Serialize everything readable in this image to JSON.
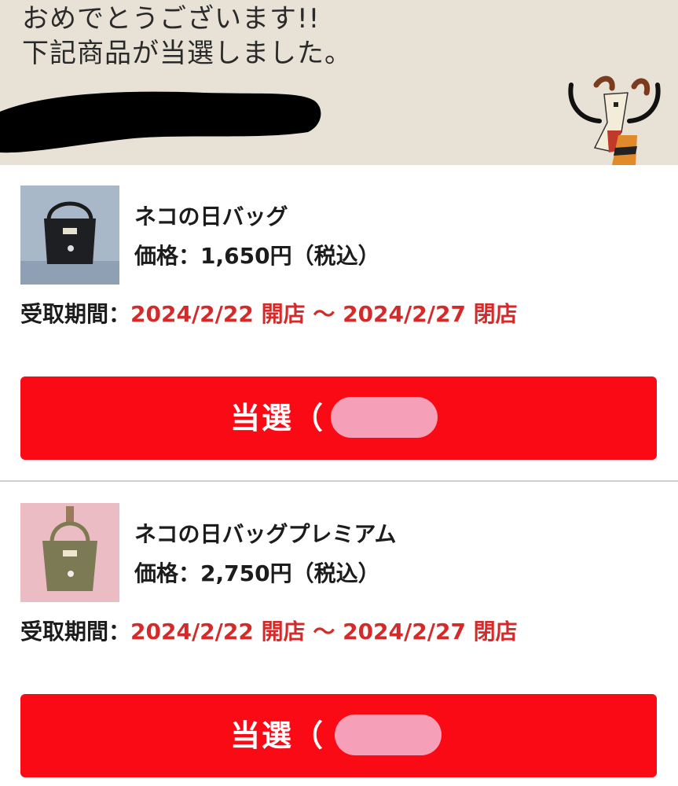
{
  "banner": {
    "line1": "おめでとうございます!!",
    "line2": "下記商品が当選しました。",
    "mascot_icon": "goat-mascot-icon"
  },
  "items": [
    {
      "name": "ネコの日バッグ",
      "price": "価格：1,650円（税込）",
      "period_label": "受取期間：",
      "period_value": "2024/2/22 開店 〜 2024/2/27 閉店",
      "button_label": "当選（",
      "image": "black-tote-bag-image"
    },
    {
      "name": "ネコの日バッグプレミアム",
      "price": "価格：2,750円（税込）",
      "period_label": "受取期間：",
      "period_value": "2024/2/22 開店 〜 2024/2/27 閉店",
      "button_label": "当選（",
      "image": "olive-tote-bag-image"
    }
  ],
  "colors": {
    "banner_bg": "#e7e1d6",
    "accent_red": "#fa0a15",
    "period_text": "#d52a2a",
    "redaction_pink": "#f5a0b8"
  }
}
